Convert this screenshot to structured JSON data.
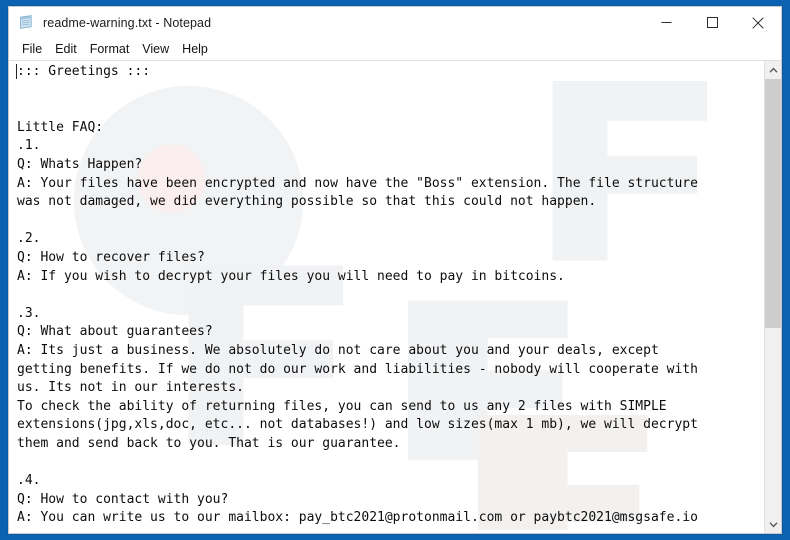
{
  "window": {
    "title": "readme-warning.txt - Notepad",
    "app_icon": "notepad-document-icon",
    "controls": {
      "minimize": "minimize-icon",
      "maximize": "maximize-icon",
      "close": "close-icon"
    }
  },
  "menu": {
    "items": [
      {
        "label": "File"
      },
      {
        "label": "Edit"
      },
      {
        "label": "Format"
      },
      {
        "label": "View"
      },
      {
        "label": "Help"
      }
    ]
  },
  "document": {
    "filename": "readme-warning.txt",
    "body": "::: Greetings :::\n\n\nLittle FAQ:\n.1.\nQ: Whats Happen?\nA: Your files have been encrypted and now have the \"Boss\" extension. The file structure\nwas not damaged, we did everything possible so that this could not happen.\n\n.2.\nQ: How to recover files?\nA: If you wish to decrypt your files you will need to pay in bitcoins.\n\n.3.\nQ: What about guarantees?\nA: Its just a business. We absolutely do not care about you and your deals, except\ngetting benefits. If we do not do our work and liabilities - nobody will cooperate with\nus. Its not in our interests.\nTo check the ability of returning files, you can send to us any 2 files with SIMPLE\nextensions(jpg,xls,doc, etc... not databases!) and low sizes(max 1 mb), we will decrypt\nthem and send back to you. That is our guarantee.\n\n.4.\nQ: How to contact with you?\nA: You can write us to our mailbox: pay_btc2021@protonmail.com or paybtc2021@msgsafe.io"
  },
  "ransom_details": {
    "file_extension": "Boss",
    "payment_method": "bitcoins",
    "test_file_count": "2",
    "test_file_types": "jpg,xls,doc",
    "max_test_size": "max 1 mb",
    "contact_emails": [
      "pay_btc2021@protonmail.com",
      "paybtc2021@msgsafe.io"
    ]
  },
  "scrollbar": {
    "up_arrow": "chevron-up-icon",
    "down_arrow": "chevron-down-icon",
    "thumb_position_percent": "0",
    "thumb_size_percent": "57"
  },
  "colors": {
    "desktop": "#0b62b0",
    "window_bg": "#ffffff",
    "text": "#0d0d0d",
    "scrollbar_thumb": "#cdcdcd",
    "scrollbar_track": "#f0f0f0"
  }
}
